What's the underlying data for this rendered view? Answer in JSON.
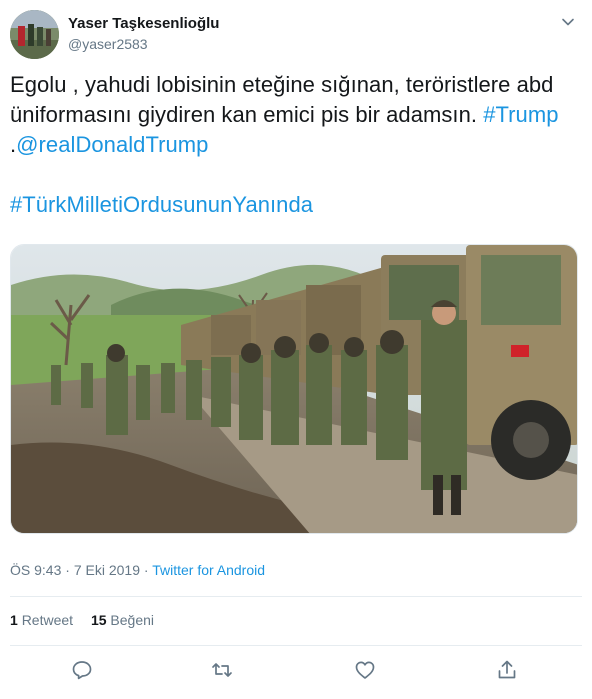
{
  "user": {
    "display_name": "Yaser Taşkesenlioğlu",
    "handle": "@yaser2583"
  },
  "tweet": {
    "line1": "Egolu , yahudi lobisinin eteğine sığınan, teröristlere abd",
    "line2_text": "üniformasını giydiren kan emici pis bir adamsın. ",
    "line2_hashtag": "#Trump",
    "line3_prefix": ".",
    "line3_mention": "@realDonaldTrump",
    "hashtag2": "#TürkMilletiOrdusununYanında"
  },
  "meta": {
    "time": "ÖS 9:43",
    "separator1": " · ",
    "date": "7 Eki 2019",
    "separator2": " · ",
    "source": "Twitter for Android"
  },
  "stats": {
    "retweets_count": "1",
    "retweets_label": "Retweet",
    "likes_count": "15",
    "likes_label": "Beğeni"
  },
  "icons": {
    "caret": "chevron-down-icon",
    "reply": "reply-icon",
    "retweet": "retweet-icon",
    "like": "heart-icon",
    "share": "share-icon"
  },
  "colors": {
    "link": "#1b95e0",
    "secondary_text": "#657786",
    "primary_text": "#14171a",
    "divider": "#e6ecf0"
  }
}
